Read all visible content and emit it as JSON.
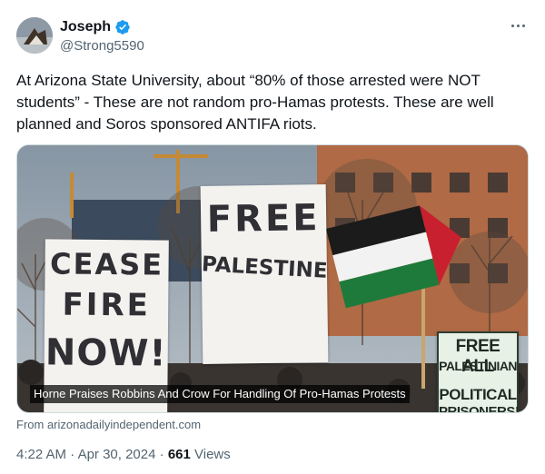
{
  "author": {
    "name": "Joseph",
    "handle": "@Strong5590",
    "verified": true,
    "avatar_icon": "avatar-image"
  },
  "more_icon": "more-options-icon",
  "tweet": {
    "text": "At Arizona State University, about “80% of those arrested were NOT students” - These are not random pro-Hamas protests. These are well planned and Soros sponsored ANTIFA riots."
  },
  "media": {
    "signs": {
      "cease": [
        "CEASE",
        "FIRE",
        "NOW!"
      ],
      "free": [
        "FREE",
        "PALESTINE"
      ],
      "political": [
        "FREE ALL",
        "PALESTINIAN",
        "POLITICAL",
        "PRISONERS!"
      ]
    },
    "caption": "Horne Praises Robbins And Crow For Handling Of Pro-Hamas Protests",
    "flag_colors": {
      "black": "#1b1b1b",
      "white": "#f2f2f2",
      "green": "#1d7a3a",
      "red": "#c8202f"
    }
  },
  "link": {
    "source": "From arizonadailyindependent.com"
  },
  "meta": {
    "time": "4:22 AM",
    "separator": "·",
    "date": "Apr 30, 2024",
    "views_count": "661",
    "views_label": "Views"
  },
  "colors": {
    "verified_blue": "#1d9bf0",
    "secondary_text": "#536471",
    "primary_text": "#0f1419"
  }
}
